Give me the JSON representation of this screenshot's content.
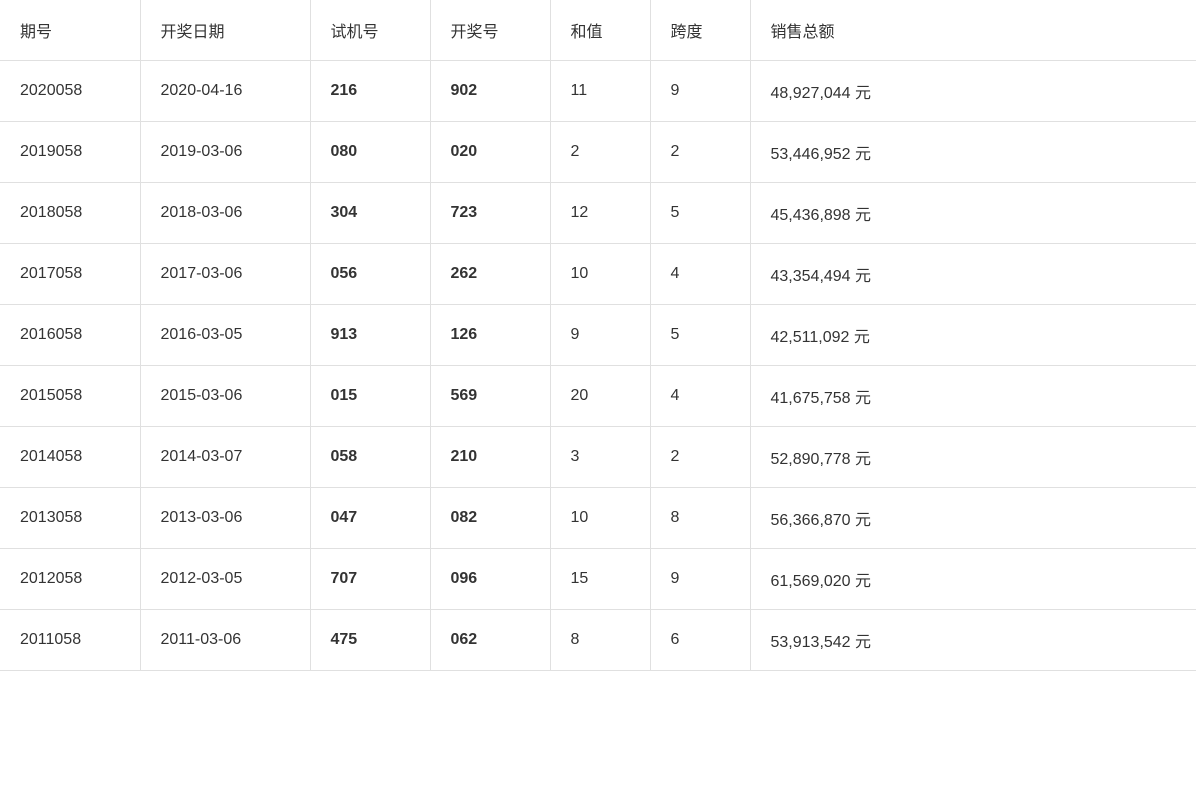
{
  "table": {
    "headers": [
      "期号",
      "开奖日期",
      "试机号",
      "开奖号",
      "和值",
      "跨度",
      "销售总额"
    ],
    "rows": [
      {
        "qihao": "2020058",
        "date": "2020-04-16",
        "shiji": "216",
        "kaijang": "902",
        "hezhi": "11",
        "kuadu": "9",
        "sales": "48,927,044 元"
      },
      {
        "qihao": "2019058",
        "date": "2019-03-06",
        "shiji": "080",
        "kaijang": "020",
        "hezhi": "2",
        "kuadu": "2",
        "sales": "53,446,952 元"
      },
      {
        "qihao": "2018058",
        "date": "2018-03-06",
        "shiji": "304",
        "kaijang": "723",
        "hezhi": "12",
        "kuadu": "5",
        "sales": "45,436,898 元"
      },
      {
        "qihao": "2017058",
        "date": "2017-03-06",
        "shiji": "056",
        "kaijang": "262",
        "hezhi": "10",
        "kuadu": "4",
        "sales": "43,354,494 元"
      },
      {
        "qihao": "2016058",
        "date": "2016-03-05",
        "shiji": "913",
        "kaijang": "126",
        "hezhi": "9",
        "kuadu": "5",
        "sales": "42,511,092 元"
      },
      {
        "qihao": "2015058",
        "date": "2015-03-06",
        "shiji": "015",
        "kaijang": "569",
        "hezhi": "20",
        "kuadu": "4",
        "sales": "41,675,758 元"
      },
      {
        "qihao": "2014058",
        "date": "2014-03-07",
        "shiji": "058",
        "kaijang": "210",
        "hezhi": "3",
        "kuadu": "2",
        "sales": "52,890,778 元"
      },
      {
        "qihao": "2013058",
        "date": "2013-03-06",
        "shiji": "047",
        "kaijang": "082",
        "hezhi": "10",
        "kuadu": "8",
        "sales": "56,366,870 元"
      },
      {
        "qihao": "2012058",
        "date": "2012-03-05",
        "shiji": "707",
        "kaijang": "096",
        "hezhi": "15",
        "kuadu": "9",
        "sales": "61,569,020 元"
      },
      {
        "qihao": "2011058",
        "date": "2011-03-06",
        "shiji": "475",
        "kaijang": "062",
        "hezhi": "8",
        "kuadu": "6",
        "sales": "53,913,542 元"
      }
    ]
  }
}
